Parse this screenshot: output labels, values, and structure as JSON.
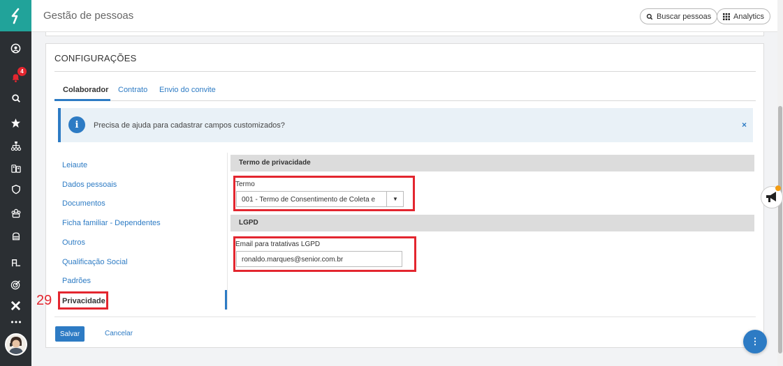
{
  "app": {
    "title": "Gestão de pessoas",
    "search_button": "Buscar pessoas",
    "analytics_button": "Analytics"
  },
  "sidebar": {
    "notification_count": "4",
    "more_label": "•••",
    "icons": [
      "user-circle-icon",
      "bell-icon",
      "search-icon",
      "star-icon",
      "org-chart-icon",
      "people-icon",
      "shield-icon",
      "group-icon",
      "backpack-icon",
      "person-add-icon",
      "target-icon",
      "close-x-icon",
      "more-icon"
    ]
  },
  "page": {
    "section_title": "CONFIGURAÇÕES",
    "tabs": [
      {
        "label": "Colaborador",
        "active": true
      },
      {
        "label": "Contrato",
        "active": false
      },
      {
        "label": "Envio do convite",
        "active": false
      }
    ],
    "info": {
      "icon": "i",
      "text": "Precisa de ajuda para cadastrar campos customizados?",
      "close": "×"
    },
    "side_menu": [
      "Leiaute",
      "Dados pessoais",
      "Documentos",
      "Ficha familiar - Dependentes",
      "Outros",
      "Qualificação Social",
      "Padrões",
      "Privacidade"
    ],
    "annotation_number": "29",
    "privacy": {
      "section_header": "Termo de privacidade",
      "term_label": "Termo",
      "term_value": "001 - Termo de Consentimento de Coleta e"
    },
    "lgpd": {
      "section_header": "LGPD",
      "email_label": "Email para tratativas LGPD",
      "email_value": "ronaldo.marques@senior.com.br"
    },
    "actions": {
      "save": "Salvar",
      "cancel": "Cancelar"
    },
    "fab_label": "⋮"
  },
  "colors": {
    "accent": "#2d7bc4",
    "brand": "#21a39a",
    "sidebar_bg": "#2b2f33",
    "highlight": "#e3262f"
  }
}
